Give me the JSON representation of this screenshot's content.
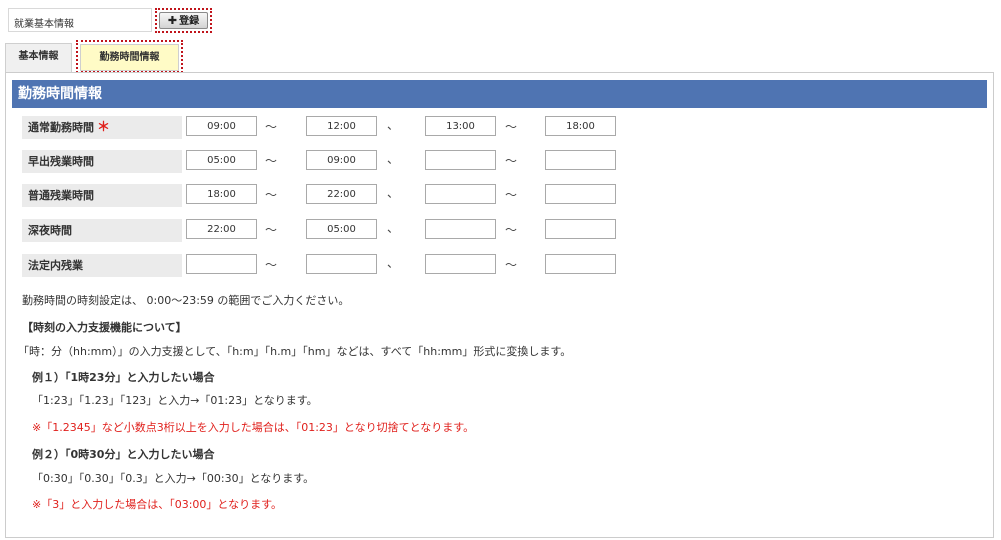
{
  "header": {
    "title": "就業基本情報",
    "register_label": "登録"
  },
  "tabs": [
    {
      "label": "基本情報"
    },
    {
      "label": "勤務時間情報"
    }
  ],
  "section": {
    "title": "勤務時間情報"
  },
  "separators": {
    "tilde": "～",
    "comma": "、"
  },
  "rows": [
    {
      "label": "通常勤務時間",
      "required": "＊",
      "values": [
        "09:00",
        "12:00",
        "13:00",
        "18:00"
      ]
    },
    {
      "label": "早出残業時間",
      "values": [
        "05:00",
        "09:00",
        "",
        ""
      ]
    },
    {
      "label": "普通残業時間",
      "values": [
        "18:00",
        "22:00",
        "",
        ""
      ]
    },
    {
      "label": "深夜時間",
      "values": [
        "22:00",
        "05:00",
        "",
        ""
      ]
    },
    {
      "label": "法定内残業",
      "values": [
        "",
        "",
        "",
        ""
      ]
    }
  ],
  "notes": {
    "range": "勤務時間の時刻設定は、 0:00～23:59 の範囲でご入力ください。",
    "heading": "【時刻の入力支援機能について】",
    "intro": "「時：分（hh:mm）」の入力支援として、「h:m」「h.m」「hm」などは、すべて「hh:mm」形式に変換します。",
    "ex1_title": "例１）「1時23分」と入力したい場合",
    "ex1_body": "「1:23」「1.23」「123」と入力→「01:23」となります。",
    "ex1_note": "※「1.2345」など小数点3桁以上を入力した場合は、「01:23」となり切捨てとなります。",
    "ex2_title": "例２）「0時30分」と入力したい場合",
    "ex2_body": "「0:30」「0.30」「0.3」と入力→「00:30」となります。",
    "ex2_note": "※「3」と入力した場合は、「03:00」となります。"
  }
}
